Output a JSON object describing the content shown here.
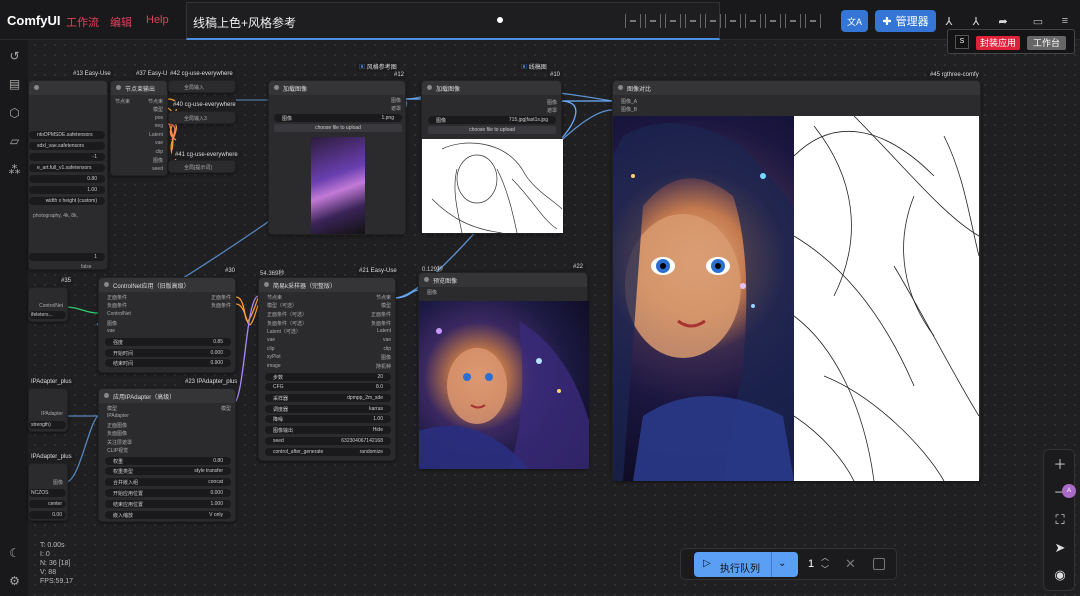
{
  "app": {
    "name": "ComfyUI",
    "menu": [
      "工作流",
      "编辑",
      "Help"
    ],
    "tab_title": "线稿上色+风格参考"
  },
  "toolbar": {
    "translate_label": "文A",
    "manager_label": "管理器",
    "popover": {
      "logo": "S",
      "app_label": "封装应用",
      "work_label": "工作台"
    }
  },
  "colors": {
    "accent": "#4a90e2",
    "menu": "#e0405a",
    "brand_red": "#e0213a",
    "run": "#5a9ff3",
    "manager": "#3575d5"
  },
  "nodes": {
    "easy_use_13": {
      "badge": "#13 Easy-Use",
      "widgets": [
        "ntoDPMSDE.safetensors",
        "sdxl_vae.safetensors",
        "-1",
        "e_art.full_v1.safetensors",
        "0.80",
        "1.00",
        "width x height (custom)"
      ],
      "prompt": "photography, 4k, 8k,",
      "seed": "1",
      "false": "false"
    },
    "node_input_37": {
      "badge": "#37 Easy-U",
      "title": "节点束输出",
      "ports_left": [
        "节点束",
        "模型",
        "正面条件",
        "负面条件",
        "Latent",
        "vae",
        "clip",
        "图像",
        "seed"
      ],
      "ports_right": [
        "节点束",
        "模型",
        "pos",
        "neg",
        "Latent",
        "vae",
        "clip",
        "图像",
        "seed"
      ]
    },
    "cg_42": {
      "badge": "#42 cg-use-everywhere",
      "label": "全局输入"
    },
    "cg_40": {
      "badge": "#40 cg-use-everywhere",
      "label": "全局输入3"
    },
    "cg_41": {
      "badge": "#41 cg-use-everywhere",
      "label": "全局[提示词]"
    },
    "load_12": {
      "badge": "#12",
      "title": "加载图像",
      "ref": "风格参考图",
      "image_label": "图像",
      "image_value": "1.png",
      "upload": "choose file to upload",
      "out": [
        "图像",
        "遮罩"
      ]
    },
    "load_10": {
      "badge": "#10",
      "title": "加载图像",
      "ref": "线稿图",
      "image_label": "图像",
      "image_value": "715.jpg|fast1s.jpg",
      "upload": "choose file to upload",
      "out": [
        "图像",
        "遮罩"
      ]
    },
    "compare_45": {
      "badge": "#45 rgthree-comfy",
      "title": "图像对比",
      "ports": [
        "图像_A",
        "图像_B"
      ]
    },
    "controlnet_30": {
      "badge": "#30",
      "title": "ControlNet应用（旧版高级）",
      "ports_left": [
        "正面条件",
        "负面条件",
        "ControlNet",
        "图像",
        "vae"
      ],
      "ports_right": [
        "正面条件",
        "负面条件"
      ],
      "widgets": [
        [
          "强度",
          "0.85"
        ],
        [
          "开始时间",
          "0.000"
        ],
        [
          "结束时间",
          "0.900"
        ]
      ]
    },
    "ipadapter_23": {
      "badge": "#23 IPAdapter_plus",
      "title": "应用IPAdapter（高级）",
      "ports_left": [
        "模型",
        "IPAdapter",
        "正面图像",
        "负面图像",
        "关注层遮罩",
        "CLIP视觉"
      ],
      "ports_right": [
        "模型"
      ],
      "widgets": [
        [
          "权重",
          "0.80"
        ],
        [
          "权重类型",
          "style transfer"
        ],
        [
          "合并嵌入组",
          "concat"
        ],
        [
          "开始应用位置",
          "0.000"
        ],
        [
          "结束应用位置",
          "1.000"
        ],
        [
          "嵌入缩放",
          "V only"
        ]
      ]
    },
    "sampler_21": {
      "time": "54.369秒",
      "badge": "#21 Easy-Use",
      "title": "简易k采样器（完整版）",
      "ports_left": [
        "节点束",
        "模型（可选）",
        "正面条件（可选）",
        "负面条件（可选）",
        "Latent（可选）",
        "vae",
        "clip",
        "xyPlot",
        "image"
      ],
      "ports_right": [
        "节点束",
        "模型",
        "正面条件",
        "负面条件",
        "Latent",
        "vae",
        "clip",
        "图像",
        "随机种"
      ],
      "widgets": [
        [
          "步数",
          "20"
        ],
        [
          "CFG",
          "8.0"
        ],
        [
          "采样器",
          "dpmpp_2m_sde"
        ],
        [
          "调度器",
          "karras"
        ],
        [
          "降噪",
          "1.00"
        ],
        [
          "图像输出",
          "Hide"
        ],
        [
          "seed",
          "632304067142168"
        ],
        [
          "control_after_generate",
          "randomize"
        ]
      ]
    },
    "preview_22": {
      "time": "0.129秒",
      "badge": "#22",
      "title": "预览图像",
      "port": "图像"
    },
    "controlnet_35": {
      "badge": "#35",
      "port": "ControlNet",
      "widget": "ifeleters..."
    },
    "ipa_left1": {
      "badge": "IPAdapter_plus",
      "port": "IPAdapter",
      "widget": "strength)"
    },
    "ipa_left2": {
      "badge": "IPAdapter_plus",
      "port": "图像",
      "widgets": [
        "NCZOS",
        "center",
        "0.00"
      ]
    }
  },
  "status": {
    "lines": [
      "T: 0.00s",
      "I: 0",
      "N: 36 [18]",
      "V: 88",
      "FPS:59.17"
    ]
  },
  "queue": {
    "run_label": "执行队列",
    "count": "1"
  },
  "sidebar_icons": [
    "history-icon",
    "queue-icon",
    "model-library-icon",
    "workflow-icon",
    "node-library-icon",
    "theme-icon",
    "settings-icon"
  ],
  "rail_icons": [
    "zoom-in-icon",
    "zoom-out-icon",
    "fit-view-icon",
    "select-icon",
    "eye-icon"
  ]
}
